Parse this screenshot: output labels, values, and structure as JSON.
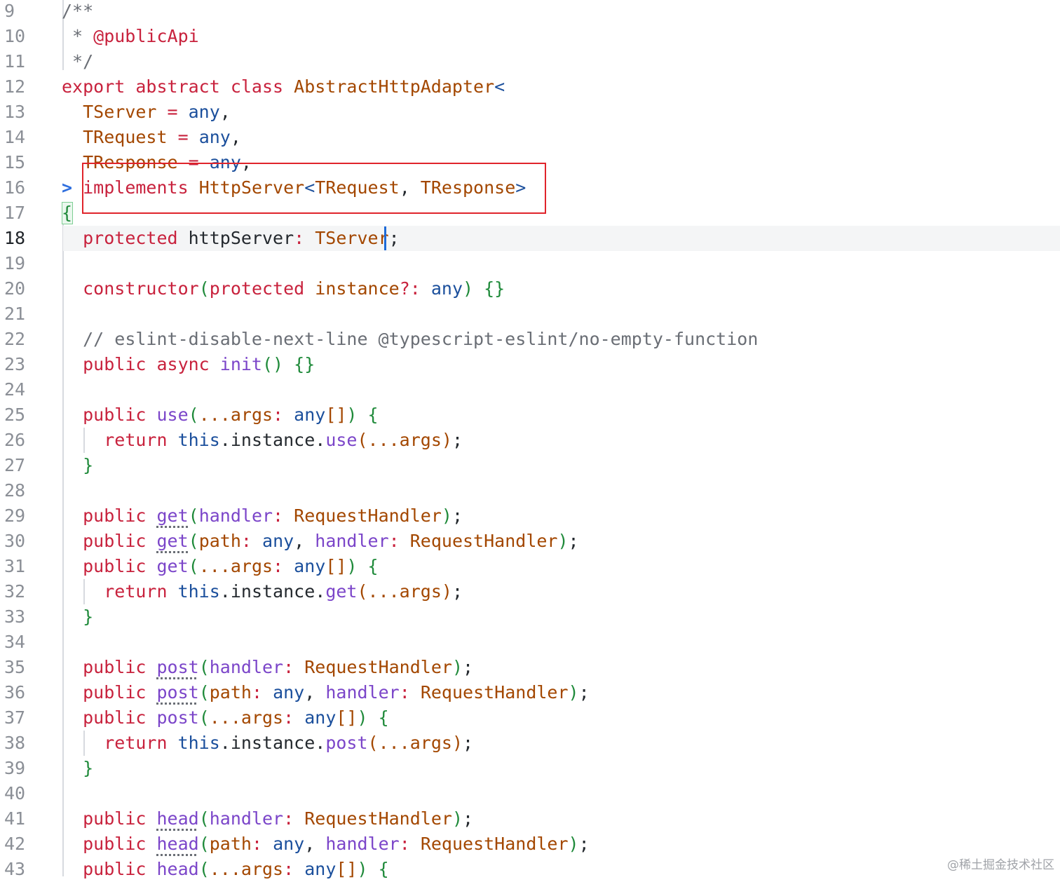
{
  "colors": {
    "keyword": "#c8223d",
    "type": "#a34700",
    "builtin": "#1b4f9c",
    "function": "#7b45c9",
    "comment": "#6a6e75",
    "paren": "#1f8a3a",
    "plain": "#24292e",
    "operator": "#c8223d",
    "accent_box": "#e0242b",
    "caret": "#1e6bd8"
  },
  "editor": {
    "current_line": "18",
    "fold_marker": ">",
    "lines": [
      {
        "n": "9",
        "t": [
          [
            "comment",
            "/**"
          ]
        ]
      },
      {
        "n": "10",
        "t": [
          [
            "comment",
            " * "
          ],
          [
            "keyword",
            "@publicApi"
          ]
        ]
      },
      {
        "n": "11",
        "t": [
          [
            "comment",
            " */"
          ]
        ]
      },
      {
        "n": "12",
        "t": [
          [
            "keyword",
            "export abstract class "
          ],
          [
            "type",
            "AbstractHttpAdapter"
          ],
          [
            "builtin",
            "<"
          ]
        ]
      },
      {
        "n": "13",
        "t": [
          [
            "plain",
            "  "
          ],
          [
            "type",
            "TServer"
          ],
          [
            "operator",
            " = "
          ],
          [
            "builtin",
            "any"
          ],
          [
            "plain",
            ","
          ]
        ]
      },
      {
        "n": "14",
        "t": [
          [
            "plain",
            "  "
          ],
          [
            "type",
            "TRequest"
          ],
          [
            "operator",
            " = "
          ],
          [
            "builtin",
            "any"
          ],
          [
            "plain",
            ","
          ]
        ]
      },
      {
        "n": "15",
        "t": [
          [
            "plain",
            "  "
          ],
          [
            "type",
            "TResponse"
          ],
          [
            "operator",
            " = "
          ],
          [
            "builtin",
            "any"
          ],
          [
            "plain",
            ","
          ]
        ]
      },
      {
        "n": "16",
        "t": [
          [
            "plain",
            "  "
          ],
          [
            "keyword",
            "implements "
          ],
          [
            "type",
            "HttpServer"
          ],
          [
            "builtin",
            "<"
          ],
          [
            "type",
            "TRequest"
          ],
          [
            "plain",
            ", "
          ],
          [
            "type",
            "TResponse"
          ],
          [
            "builtin",
            ">"
          ]
        ]
      },
      {
        "n": "17",
        "t": [
          [
            "paren",
            "{"
          ]
        ]
      },
      {
        "n": "18",
        "t": [
          [
            "plain",
            "  "
          ],
          [
            "keyword",
            "protected "
          ],
          [
            "plain",
            "httpServer"
          ],
          [
            "operator",
            ": "
          ],
          [
            "type",
            "TServer"
          ],
          [
            "plain",
            ";"
          ]
        ]
      },
      {
        "n": "19",
        "t": []
      },
      {
        "n": "20",
        "t": [
          [
            "plain",
            "  "
          ],
          [
            "keyword",
            "constructor"
          ],
          [
            "paren",
            "("
          ],
          [
            "keyword",
            "protected "
          ],
          [
            "type",
            "instance"
          ],
          [
            "operator",
            "?: "
          ],
          [
            "builtin",
            "any"
          ],
          [
            "paren",
            ") {}"
          ]
        ]
      },
      {
        "n": "21",
        "t": []
      },
      {
        "n": "22",
        "t": [
          [
            "plain",
            "  "
          ],
          [
            "comment",
            "// eslint-disable-next-line @typescript-eslint/no-empty-function"
          ]
        ]
      },
      {
        "n": "23",
        "t": [
          [
            "plain",
            "  "
          ],
          [
            "keyword",
            "public async "
          ],
          [
            "function",
            "init"
          ],
          [
            "paren",
            "() {}"
          ]
        ]
      },
      {
        "n": "24",
        "t": []
      },
      {
        "n": "25",
        "t": [
          [
            "plain",
            "  "
          ],
          [
            "keyword",
            "public "
          ],
          [
            "function",
            "use"
          ],
          [
            "paren",
            "("
          ],
          [
            "type",
            "...args"
          ],
          [
            "operator",
            ": "
          ],
          [
            "builtin",
            "any"
          ],
          [
            "type",
            "[]"
          ],
          [
            "paren",
            ") {"
          ]
        ]
      },
      {
        "n": "26",
        "t": [
          [
            "plain",
            "    "
          ],
          [
            "keyword",
            "return "
          ],
          [
            "builtin",
            "this"
          ],
          [
            "plain",
            ".instance."
          ],
          [
            "function",
            "use"
          ],
          [
            "type",
            "(...args)"
          ],
          [
            "plain",
            ";"
          ]
        ]
      },
      {
        "n": "27",
        "t": [
          [
            "plain",
            "  "
          ],
          [
            "paren",
            "}"
          ]
        ]
      },
      {
        "n": "28",
        "t": []
      },
      {
        "n": "29",
        "t": [
          [
            "plain",
            "  "
          ],
          [
            "keyword",
            "public "
          ],
          [
            "function",
            "get",
            "sq"
          ],
          [
            "paren",
            "("
          ],
          [
            "function",
            "handler"
          ],
          [
            "operator",
            ": "
          ],
          [
            "type",
            "RequestHandler"
          ],
          [
            "paren",
            ")"
          ],
          [
            "plain",
            ";"
          ]
        ]
      },
      {
        "n": "30",
        "t": [
          [
            "plain",
            "  "
          ],
          [
            "keyword",
            "public "
          ],
          [
            "function",
            "get",
            "sq"
          ],
          [
            "paren",
            "("
          ],
          [
            "type",
            "path"
          ],
          [
            "operator",
            ": "
          ],
          [
            "builtin",
            "any"
          ],
          [
            "plain",
            ", "
          ],
          [
            "function",
            "handler"
          ],
          [
            "operator",
            ": "
          ],
          [
            "type",
            "RequestHandler"
          ],
          [
            "paren",
            ")"
          ],
          [
            "plain",
            ";"
          ]
        ]
      },
      {
        "n": "31",
        "t": [
          [
            "plain",
            "  "
          ],
          [
            "keyword",
            "public "
          ],
          [
            "function",
            "get"
          ],
          [
            "paren",
            "("
          ],
          [
            "type",
            "...args"
          ],
          [
            "operator",
            ": "
          ],
          [
            "builtin",
            "any"
          ],
          [
            "type",
            "[]"
          ],
          [
            "paren",
            ") {"
          ]
        ]
      },
      {
        "n": "32",
        "t": [
          [
            "plain",
            "    "
          ],
          [
            "keyword",
            "return "
          ],
          [
            "builtin",
            "this"
          ],
          [
            "plain",
            ".instance."
          ],
          [
            "function",
            "get"
          ],
          [
            "type",
            "(...args)"
          ],
          [
            "plain",
            ";"
          ]
        ]
      },
      {
        "n": "33",
        "t": [
          [
            "plain",
            "  "
          ],
          [
            "paren",
            "}"
          ]
        ]
      },
      {
        "n": "34",
        "t": []
      },
      {
        "n": "35",
        "t": [
          [
            "plain",
            "  "
          ],
          [
            "keyword",
            "public "
          ],
          [
            "function",
            "post",
            "sq"
          ],
          [
            "paren",
            "("
          ],
          [
            "function",
            "handler"
          ],
          [
            "operator",
            ": "
          ],
          [
            "type",
            "RequestHandler"
          ],
          [
            "paren",
            ")"
          ],
          [
            "plain",
            ";"
          ]
        ]
      },
      {
        "n": "36",
        "t": [
          [
            "plain",
            "  "
          ],
          [
            "keyword",
            "public "
          ],
          [
            "function",
            "post",
            "sq"
          ],
          [
            "paren",
            "("
          ],
          [
            "type",
            "path"
          ],
          [
            "operator",
            ": "
          ],
          [
            "builtin",
            "any"
          ],
          [
            "plain",
            ", "
          ],
          [
            "function",
            "handler"
          ],
          [
            "operator",
            ": "
          ],
          [
            "type",
            "RequestHandler"
          ],
          [
            "paren",
            ")"
          ],
          [
            "plain",
            ";"
          ]
        ]
      },
      {
        "n": "37",
        "t": [
          [
            "plain",
            "  "
          ],
          [
            "keyword",
            "public "
          ],
          [
            "function",
            "post"
          ],
          [
            "paren",
            "("
          ],
          [
            "type",
            "...args"
          ],
          [
            "operator",
            ": "
          ],
          [
            "builtin",
            "any"
          ],
          [
            "type",
            "[]"
          ],
          [
            "paren",
            ") {"
          ]
        ]
      },
      {
        "n": "38",
        "t": [
          [
            "plain",
            "    "
          ],
          [
            "keyword",
            "return "
          ],
          [
            "builtin",
            "this"
          ],
          [
            "plain",
            ".instance."
          ],
          [
            "function",
            "post"
          ],
          [
            "type",
            "(...args)"
          ],
          [
            "plain",
            ";"
          ]
        ]
      },
      {
        "n": "39",
        "t": [
          [
            "plain",
            "  "
          ],
          [
            "paren",
            "}"
          ]
        ]
      },
      {
        "n": "40",
        "t": []
      },
      {
        "n": "41",
        "t": [
          [
            "plain",
            "  "
          ],
          [
            "keyword",
            "public "
          ],
          [
            "function",
            "head",
            "sq"
          ],
          [
            "paren",
            "("
          ],
          [
            "function",
            "handler"
          ],
          [
            "operator",
            ": "
          ],
          [
            "type",
            "RequestHandler"
          ],
          [
            "paren",
            ")"
          ],
          [
            "plain",
            ";"
          ]
        ]
      },
      {
        "n": "42",
        "t": [
          [
            "plain",
            "  "
          ],
          [
            "keyword",
            "public "
          ],
          [
            "function",
            "head",
            "sq"
          ],
          [
            "paren",
            "("
          ],
          [
            "type",
            "path"
          ],
          [
            "operator",
            ": "
          ],
          [
            "builtin",
            "any"
          ],
          [
            "plain",
            ", "
          ],
          [
            "function",
            "handler"
          ],
          [
            "operator",
            ": "
          ],
          [
            "type",
            "RequestHandler"
          ],
          [
            "paren",
            ")"
          ],
          [
            "plain",
            ";"
          ]
        ]
      },
      {
        "n": "43",
        "t": [
          [
            "plain",
            "  "
          ],
          [
            "keyword",
            "public "
          ],
          [
            "function",
            "head"
          ],
          [
            "paren",
            "("
          ],
          [
            "type",
            "...args"
          ],
          [
            "operator",
            ": "
          ],
          [
            "builtin",
            "any"
          ],
          [
            "type",
            "[]"
          ],
          [
            "paren",
            ") {"
          ]
        ]
      }
    ]
  },
  "watermark": "@稀土掘金技术社区"
}
